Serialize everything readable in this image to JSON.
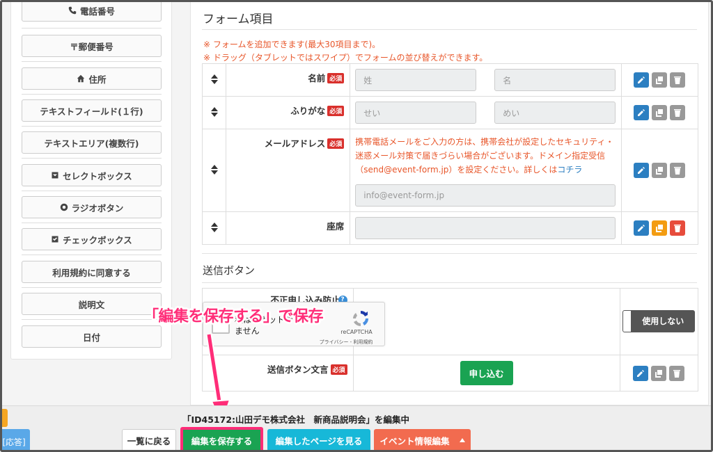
{
  "sidebar": {
    "items": [
      {
        "label": "電話番号",
        "icon": "phone-icon"
      },
      {
        "label": "〒郵便番号",
        "icon": ""
      },
      {
        "label": "住所",
        "icon": "home-icon"
      },
      {
        "label": "テキストフィールド(１行)",
        "icon": ""
      },
      {
        "label": "テキストエリア(複数行)",
        "icon": ""
      },
      {
        "label": "セレクトボックス",
        "icon": "select-icon"
      },
      {
        "label": "ラジオボタン",
        "icon": "radio-icon"
      },
      {
        "label": "チェックボックス",
        "icon": "checkbox-icon"
      },
      {
        "label": "利用規約に同意する",
        "icon": ""
      },
      {
        "label": "説明文",
        "icon": ""
      },
      {
        "label": "日付",
        "icon": ""
      }
    ]
  },
  "form_section": {
    "title": "フォーム項目",
    "notes": [
      "※ フォームを追加できます(最大30項目まで)。",
      "※ ドラッグ（タブレットではスワイプ）でフォームの並び替えができます。"
    ],
    "required_badge": "必須",
    "rows": [
      {
        "label": "名前",
        "placeholders": [
          "姓",
          "名"
        ]
      },
      {
        "label": "ふりがな",
        "placeholders": [
          "せい",
          "めい"
        ]
      },
      {
        "label": "メールアドレス",
        "notice": "携帯電話メールをご入力の方は、携帯会社が設定したセキュリティ・迷惑メール対策で届きづらい場合がございます。ドメイン指定受信（send@event-form.jp）を設定ください。詳しくは",
        "notice_link": "コチラ",
        "placeholder": "info@event-form.jp"
      },
      {
        "label": "座席"
      }
    ]
  },
  "submit_section": {
    "title": "送信ボタン",
    "spam_label": "不正申し込み防止",
    "recaptcha": {
      "text": "私はロボットではありません",
      "brand": "reCAPTCHA",
      "terms": "プライバシー - 利用規約"
    },
    "toggle_label": "使用しない",
    "submit_text_label": "送信ボタン文言",
    "submit_button": "申し込む"
  },
  "footer": {
    "editing_title": "「ID45172:山田デモ株式会社　新商品説明会」を編集中",
    "left_tab": "[応答]",
    "back": "一覧に戻る",
    "save": "編集を保存する",
    "view": "編集したページを見る",
    "event_edit": "イベント情報編集"
  },
  "annotation": "「編集を保存する」で保存",
  "colors": {
    "accent_pink": "#ff2d78",
    "save_green": "#1aa352",
    "view_cyan": "#17b8d8",
    "event_orange": "#f26b4f"
  }
}
